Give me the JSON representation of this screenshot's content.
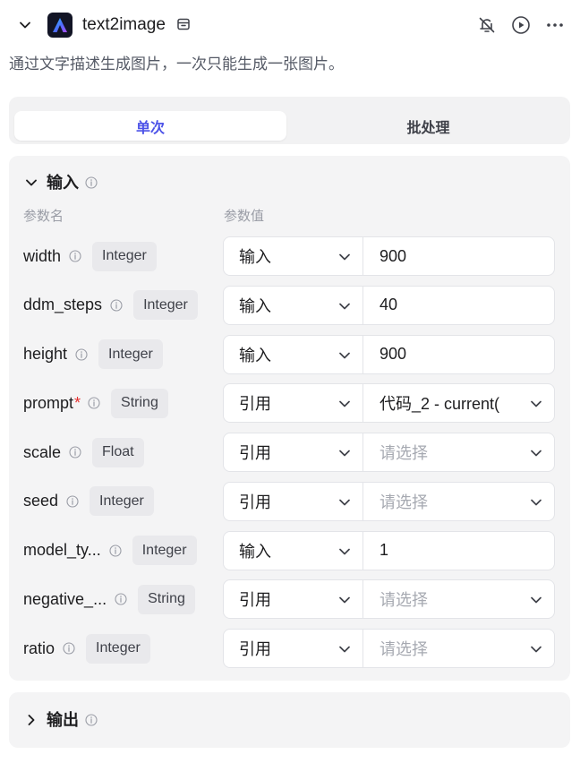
{
  "header": {
    "title": "text2image",
    "description": "通过文字描述生成图片，一次只能生成一张图片。"
  },
  "tabs": [
    {
      "label": "单次",
      "active": true
    },
    {
      "label": "批处理",
      "active": false
    }
  ],
  "input_section": {
    "title": "输入",
    "col_name": "参数名",
    "col_value": "参数值",
    "params": [
      {
        "name": "width",
        "required": "",
        "type": "Integer",
        "mode": "输入",
        "value": "900",
        "placeholder": "",
        "kind": "input"
      },
      {
        "name": "ddm_steps",
        "required": "",
        "type": "Integer",
        "mode": "输入",
        "value": "40",
        "placeholder": "",
        "kind": "input"
      },
      {
        "name": "height",
        "required": "",
        "type": "Integer",
        "mode": "输入",
        "value": "900",
        "placeholder": "",
        "kind": "input"
      },
      {
        "name": "prompt",
        "required": "*",
        "type": "String",
        "mode": "引用",
        "value": "代码_2 - current(",
        "placeholder": "",
        "kind": "select"
      },
      {
        "name": "scale",
        "required": "",
        "type": "Float",
        "mode": "引用",
        "value": "",
        "placeholder": "请选择",
        "kind": "select"
      },
      {
        "name": "seed",
        "required": "",
        "type": "Integer",
        "mode": "引用",
        "value": "",
        "placeholder": "请选择",
        "kind": "select"
      },
      {
        "name": "model_ty...",
        "required": "",
        "type": "Integer",
        "mode": "输入",
        "value": "1",
        "placeholder": "",
        "kind": "input"
      },
      {
        "name": "negative_...",
        "required": "",
        "type": "String",
        "mode": "引用",
        "value": "",
        "placeholder": "请选择",
        "kind": "select"
      },
      {
        "name": "ratio",
        "required": "",
        "type": "Integer",
        "mode": "引用",
        "value": "",
        "placeholder": "请选择",
        "kind": "select"
      }
    ]
  },
  "output_section": {
    "title": "输出"
  },
  "icons": {
    "collapse": "chevron-down-icon",
    "logo": "app-logo-icon",
    "store": "store-icon",
    "alert": "alert-off-icon",
    "run": "play-circle-icon",
    "more": "more-icon",
    "info": "info-icon"
  },
  "colors": {
    "accent": "#4d53e8",
    "required": "#e5302f",
    "panel_bg": "#f4f4f5"
  }
}
